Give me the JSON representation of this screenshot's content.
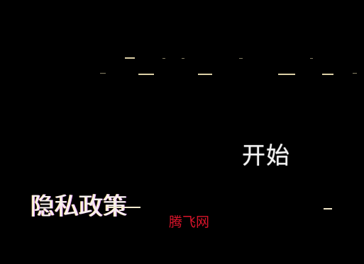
{
  "menu": {
    "start_label": "开始",
    "privacy_label": "隐私政策"
  },
  "watermark": {
    "text": "腾飞网",
    "color": "#d9142a"
  },
  "colors": {
    "background": "#000000",
    "text": "#f2f2f2",
    "glitch": "#f4e7b8"
  }
}
